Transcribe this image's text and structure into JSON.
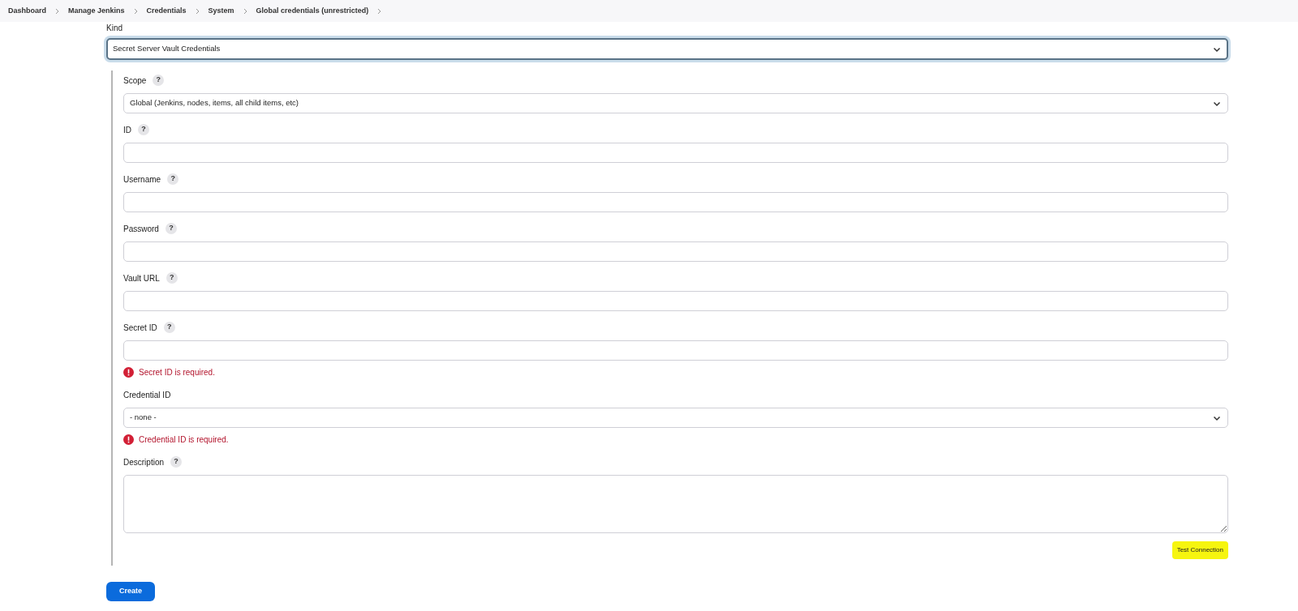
{
  "breadcrumbs": [
    "Dashboard",
    "Manage Jenkins",
    "Credentials",
    "System",
    "Global credentials (unrestricted)"
  ],
  "kind": {
    "label": "Kind",
    "value": "Secret Server Vault Credentials",
    "focused": true
  },
  "fields": [
    {
      "kind": "select",
      "label": "Scope",
      "help": "?",
      "value": "Global (Jenkins, nodes, items, all child items, etc)"
    },
    {
      "kind": "text",
      "label": "ID",
      "help": "?"
    },
    {
      "kind": "text",
      "label": "Username",
      "help": "?"
    },
    {
      "kind": "text",
      "label": "Password",
      "help": "?"
    },
    {
      "kind": "text",
      "label": "Vault URL",
      "help": "?"
    },
    {
      "kind": "text",
      "label": "Secret ID",
      "help": "?",
      "error": "Secret ID is required."
    },
    {
      "kind": "select",
      "label": "Credential ID",
      "value": "- none -",
      "error": "Credential ID is required."
    },
    {
      "kind": "textarea",
      "label": "Description",
      "help": "?"
    }
  ],
  "test_button": {
    "label": "Test Connection",
    "highlighted": true
  },
  "create_button": "Create"
}
